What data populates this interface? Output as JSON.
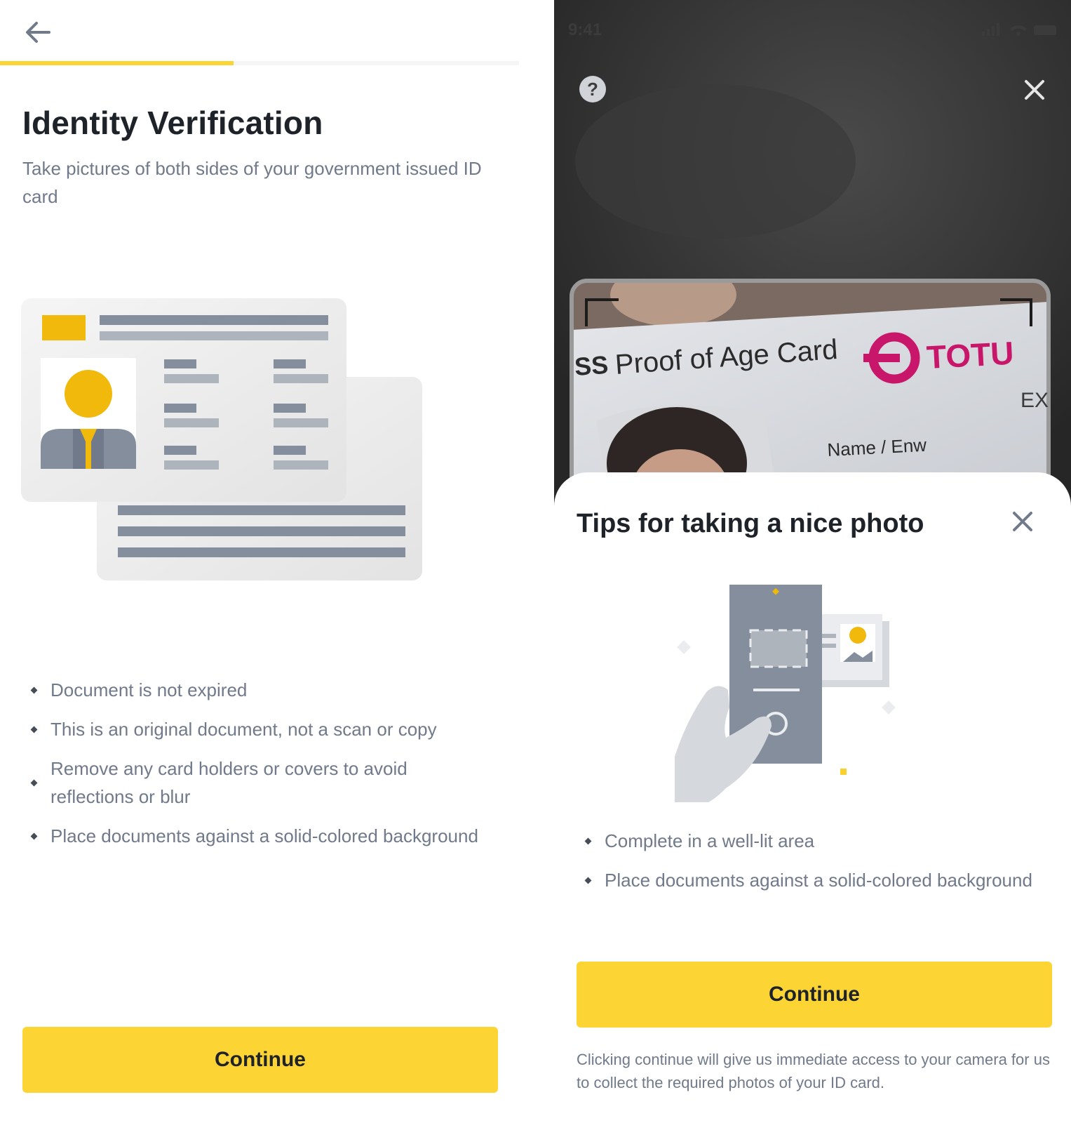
{
  "left": {
    "progress_fraction": 0.45,
    "title": "Identity Verification",
    "subtitle": "Take pictures of both sides of your government issued ID card",
    "requirements": [
      "Document is not expired",
      "This is an original document, not a scan or copy",
      "Remove any card holders or covers to avoid reflections or blur",
      "Place documents against a solid-colored background"
    ],
    "continue_label": "Continue"
  },
  "right": {
    "status_time": "9:41",
    "help_glyph": "?",
    "card_preview": {
      "card_text": "SS Proof of Age Card",
      "brand_text": "TOTU",
      "field_label": "Name / Enw",
      "expiry_fragment": "EX"
    },
    "sheet": {
      "title": "Tips for taking a nice photo",
      "tips": [
        "Complete in a well-lit area",
        "Place documents against a solid-colored background"
      ],
      "continue_label": "Continue",
      "note": "Clicking continue will give us immediate access to your camera for us to collect the required photos of your ID card."
    }
  },
  "colors": {
    "accent": "#fcd535",
    "text_primary": "#1e2329",
    "text_secondary": "#707a8a",
    "illustration_gray": "#848e9c",
    "brand_magenta": "#c8176b"
  },
  "icons": {
    "back": "arrow-left-icon",
    "help": "question-mark-icon",
    "close": "close-icon"
  }
}
